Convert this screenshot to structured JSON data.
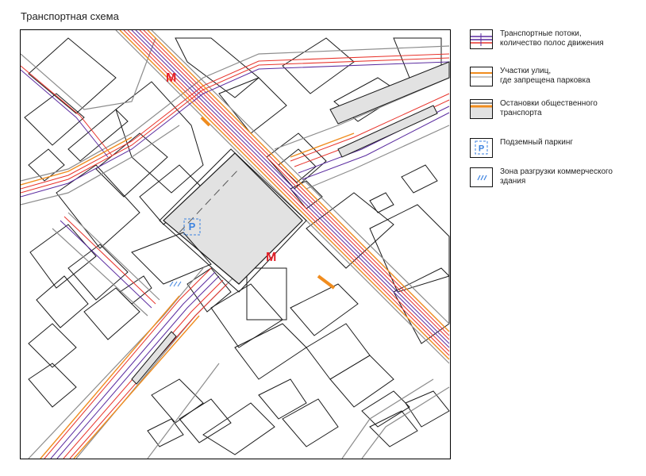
{
  "title": "Транспортная схема",
  "map": {
    "metro_symbol": "М",
    "parking_symbol": "P",
    "colors": {
      "traffic_red": "#e8322a",
      "traffic_purple": "#5b2ca0",
      "no_parking_orange": "#f08c1e",
      "stop_fill": "#e2e2e2",
      "road_gray": "#8c8c8c",
      "building_outline": "#1a1a1a",
      "parking_blue": "#3b82e0",
      "metro_red": "#e4232b"
    }
  },
  "legend": {
    "items": [
      {
        "icon": "traffic-flow-icon",
        "label": "Транспортные потоки,\nколичество полос движения"
      },
      {
        "icon": "no-parking-street-icon",
        "label": "Участки улиц,\nгде запрещена парковка"
      },
      {
        "icon": "transit-stop-icon",
        "label": "Остановки общественного\nтранспорта"
      },
      {
        "icon": "underground-parking-icon",
        "label": "Подземный паркинг",
        "symbol": "P"
      },
      {
        "icon": "loading-zone-icon",
        "label": "Зона разгрузки коммерческого\nздания"
      }
    ]
  }
}
